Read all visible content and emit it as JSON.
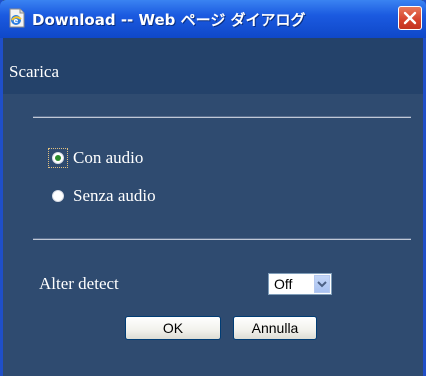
{
  "window": {
    "title": "Download -- Web ページ ダイアログ",
    "close_icon": "close-icon"
  },
  "header": {
    "section_title": "Scarica"
  },
  "audio_options": [
    {
      "label": "Con audio",
      "selected": true
    },
    {
      "label": "Senza audio",
      "selected": false
    }
  ],
  "alter_detect": {
    "label": "Alter detect",
    "value": "Off"
  },
  "buttons": {
    "ok_label": "OK",
    "cancel_label": "Annulla"
  },
  "colors": {
    "titlebar": "#1b5ae0",
    "background": "#2f4b70",
    "header_band": "#24426a",
    "close_button": "#d5412b"
  }
}
